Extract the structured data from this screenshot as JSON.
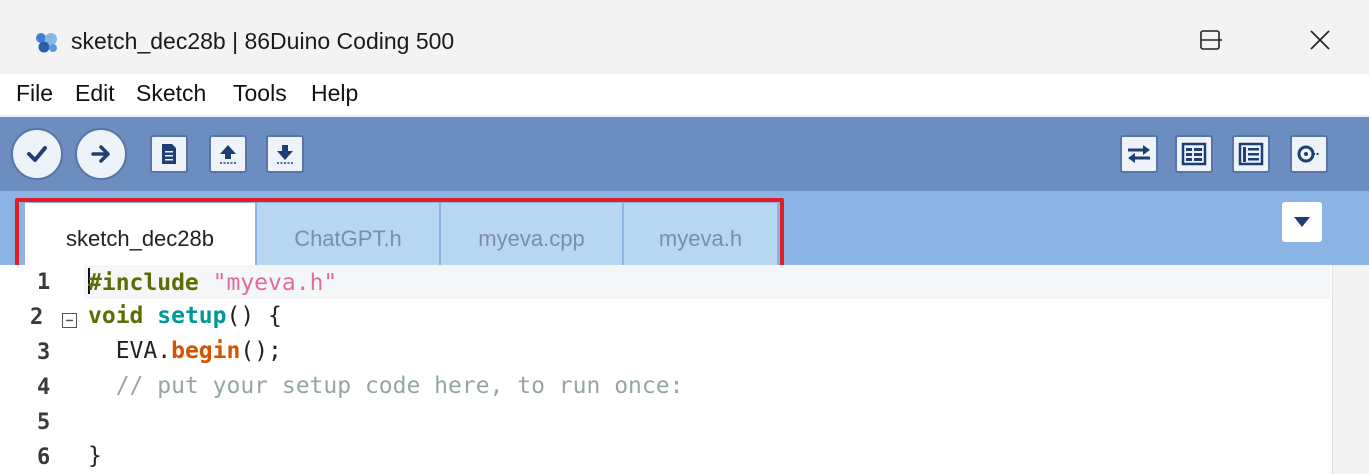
{
  "window": {
    "title": "sketch_dec28b | 86Duino Coding 500",
    "app_icon": "86duino-logo-icon",
    "controls": [
      "minimize-icon",
      "maximize-icon",
      "close-icon"
    ]
  },
  "menu": {
    "items": [
      "File",
      "Edit",
      "Sketch",
      "Tools",
      "Help"
    ]
  },
  "toolbar": {
    "left_buttons": [
      "verify-icon",
      "upload-icon",
      "new-icon",
      "open-icon",
      "save-icon"
    ],
    "right_buttons": [
      "serial-plotter-icon",
      "serial-monitor-icon",
      "library-manager-icon",
      "search-icon"
    ]
  },
  "tabs": {
    "items": [
      "sketch_dec28b",
      "ChatGPT.h",
      "myeva.cpp",
      "myeva.h"
    ],
    "active": "sketch_dec28b",
    "menu_icon": "tab-dropdown-icon",
    "highlight_color": "#e01e26"
  },
  "editor": {
    "line_numbers": [
      "1",
      "2",
      "3",
      "4",
      "5",
      "6"
    ],
    "lines": {
      "l1": {
        "directive": "#include",
        "space": " ",
        "header": "\"myeva.h\""
      },
      "l2": {
        "type": "void",
        "space": " ",
        "func": "setup",
        "rest": "() {"
      },
      "l3": {
        "indent": "  ",
        "object": "EVA.",
        "method": "begin",
        "rest": "();"
      },
      "l4": {
        "comment": "  // put your setup code here, to run once:"
      },
      "l5": {
        "text": ""
      },
      "l6": {
        "text": "}"
      }
    }
  },
  "colors": {
    "toolbar": "#6b8dbf",
    "tabs_bar": "#8bb4e4",
    "inactive_tab": "#b9d6f0",
    "keyword": "#5e6d03",
    "string": "#e06c9f",
    "function": "#d35400",
    "comment": "#95a5a6"
  }
}
